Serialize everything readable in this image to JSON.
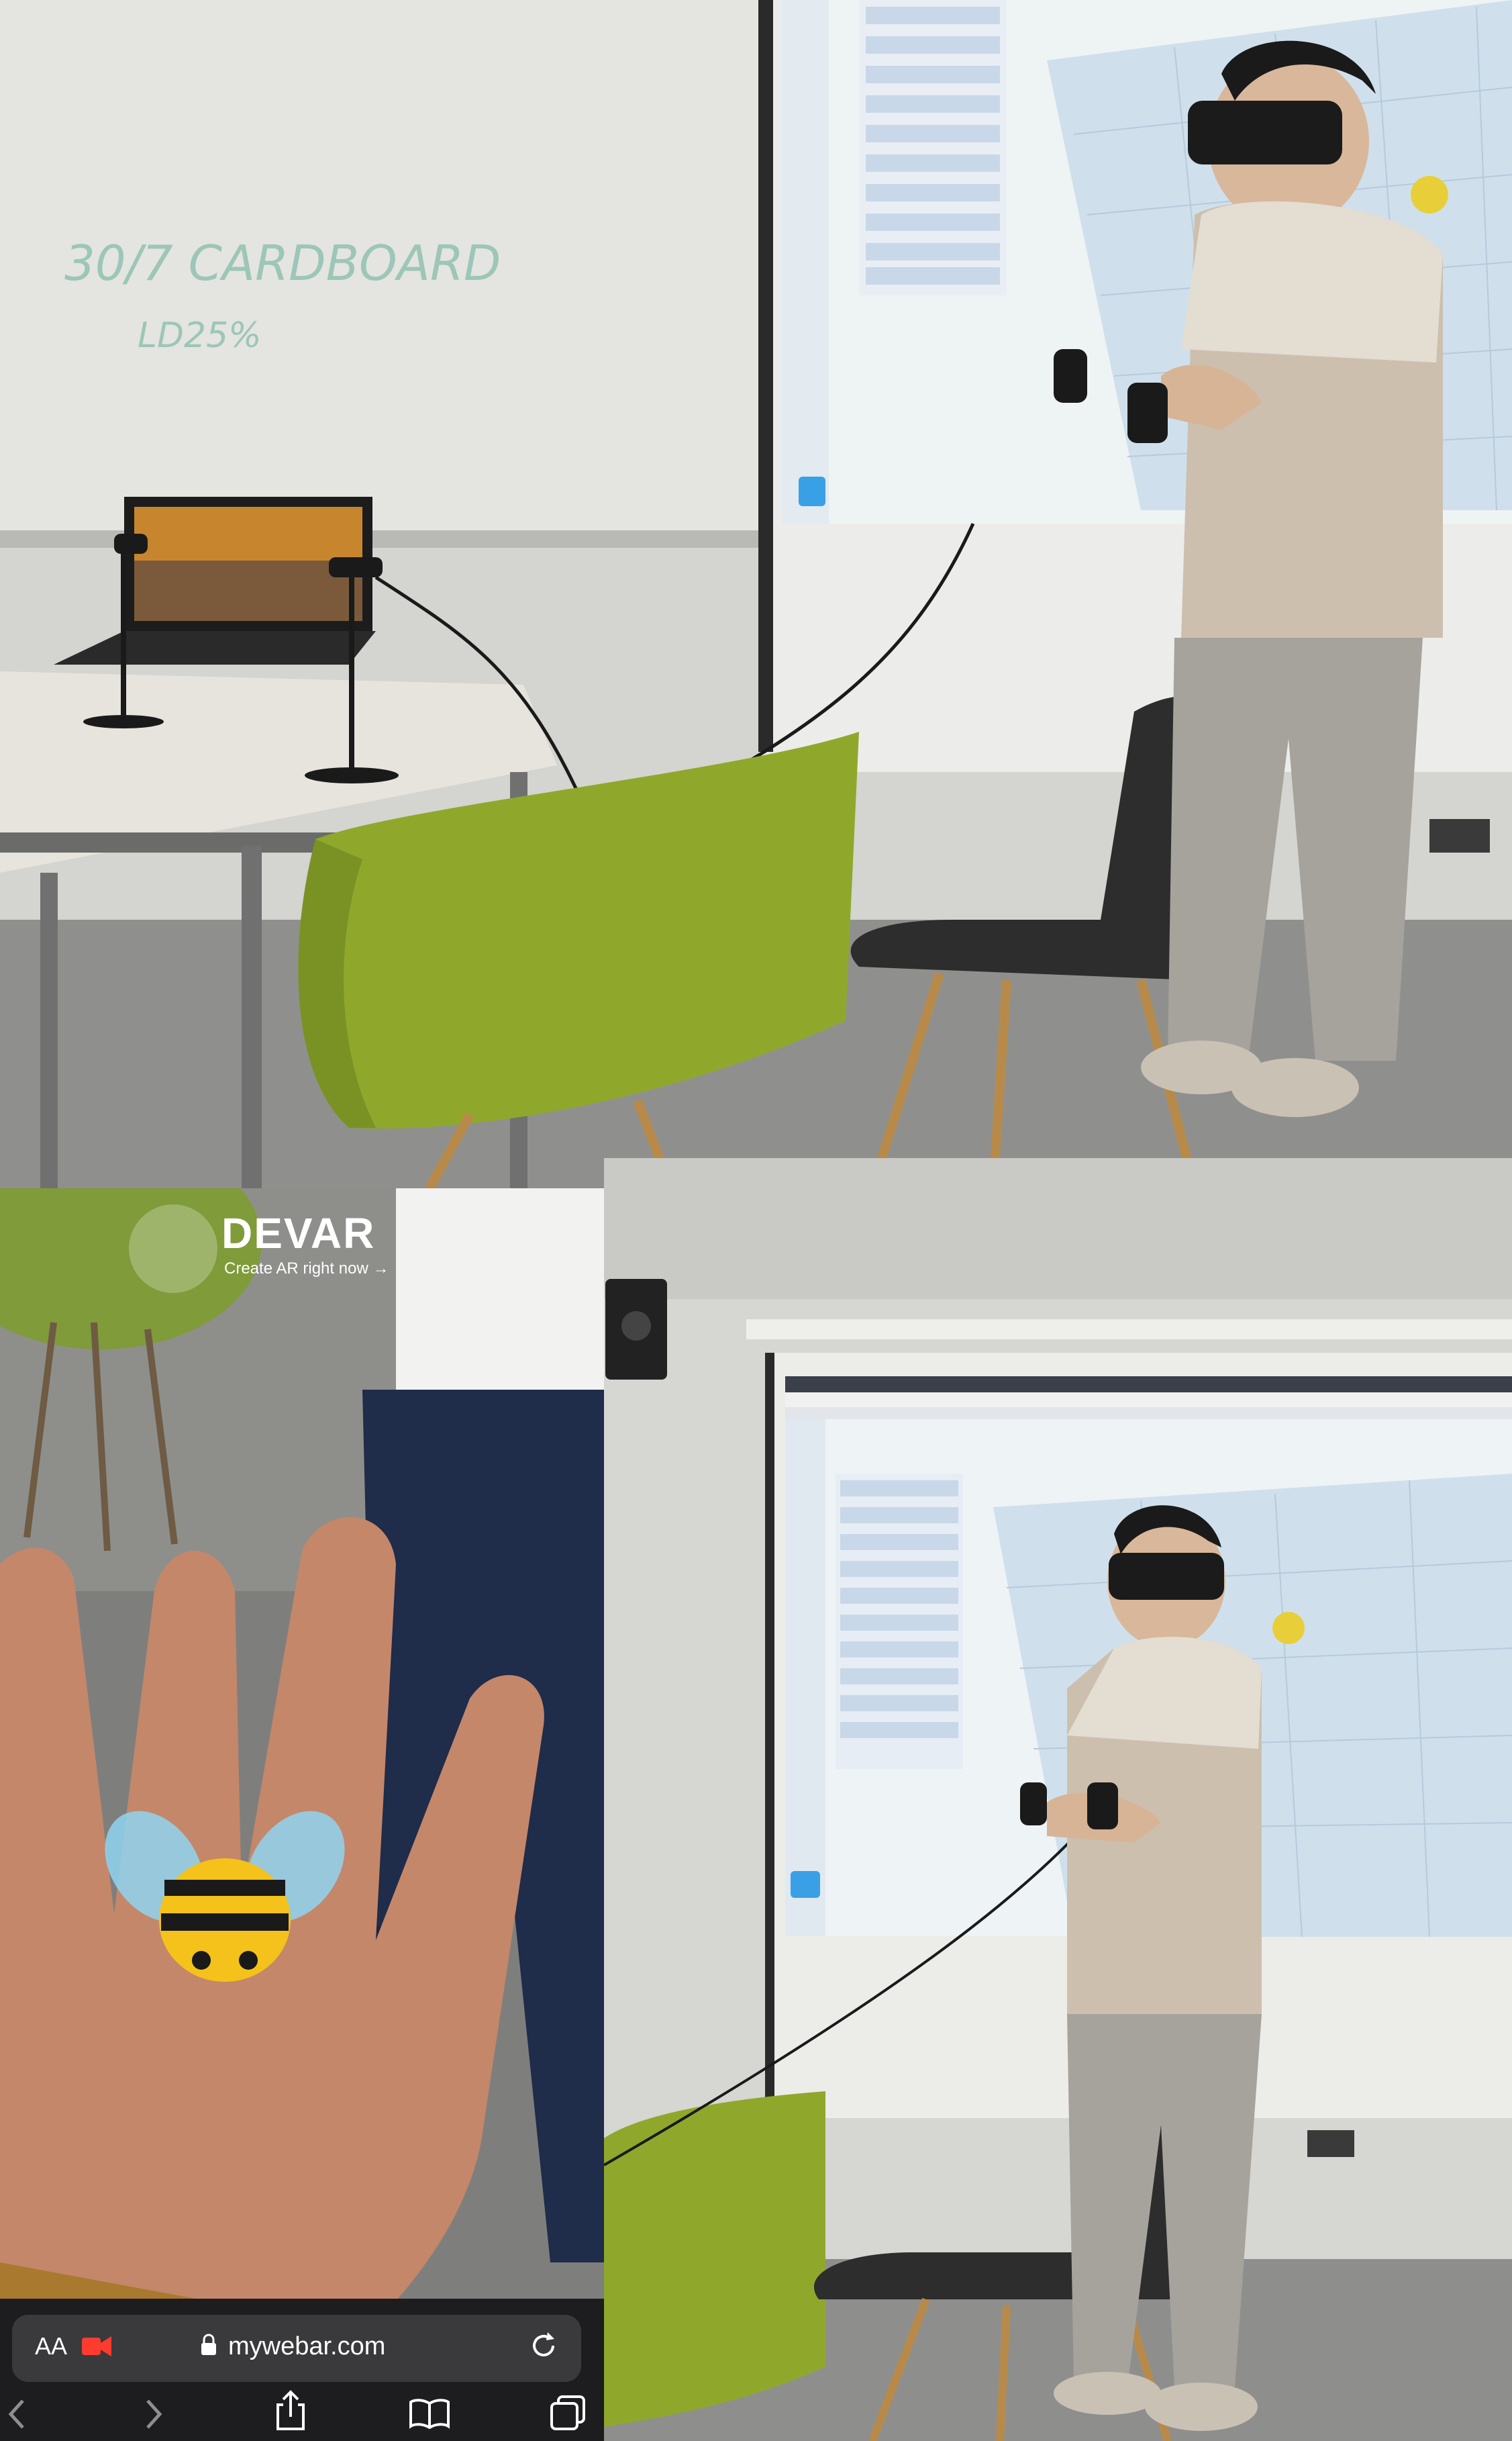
{
  "whiteboard": {
    "line1": "30/7  CARDBOARD",
    "line2": "LD25%"
  },
  "ar_app": {
    "logo": "DEVAR",
    "tagline": "Create AR right now →"
  },
  "browser": {
    "text_size_label": "AA",
    "url": "mywebar.com"
  },
  "icons": {
    "record": "record-icon",
    "lock": "lock-icon",
    "reload": "reload-icon",
    "back": "back-icon",
    "forward": "forward-icon",
    "share": "share-icon",
    "bookmarks": "bookmarks-icon",
    "tabs": "tabs-icon"
  },
  "colors": {
    "chair_green": "#8fa82c",
    "screen_blue": "#3aa0e6",
    "bee_yellow": "#f4c21a",
    "safari_bar": "#1d1d1f"
  }
}
